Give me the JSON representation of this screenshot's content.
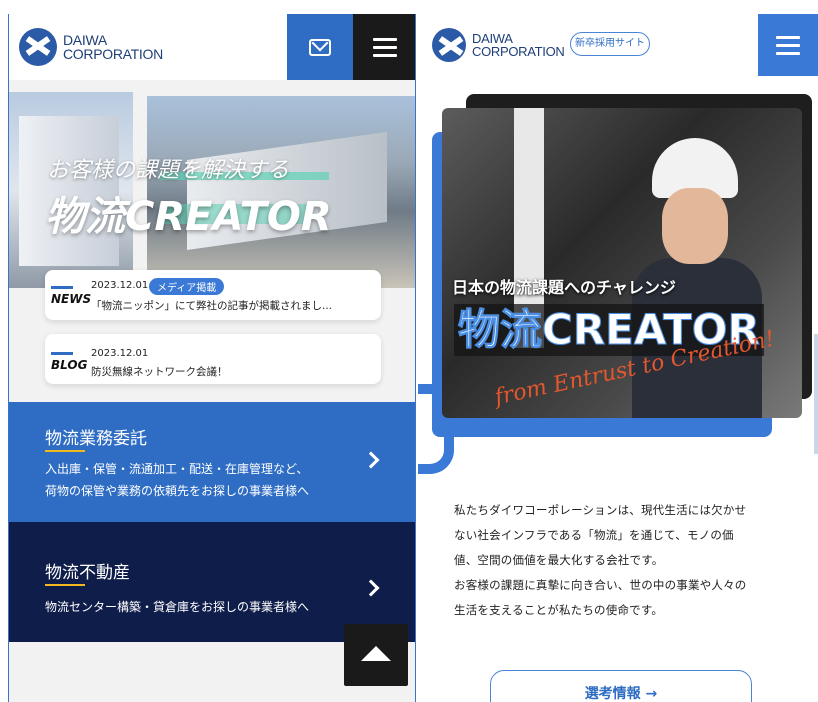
{
  "left": {
    "logo": {
      "line1": "DAIWA",
      "line2": "CORPORATION"
    },
    "hero": {
      "catch": "お客様の課題を解決する",
      "big": "物流CREATOR"
    },
    "news": {
      "tag": "NEWS",
      "date": "2023.12.01",
      "badge": "メディア掲載",
      "title": "「物流ニッポン」にて弊社の記事が掲載されまし..."
    },
    "blog": {
      "tag": "BLOG",
      "date": "2023.12.01",
      "title": "防災無線ネットワーク会議！"
    },
    "service1": {
      "title": "物流業務委託",
      "desc1": "入出庫・保管・流通加工・配送・在庫管理など、",
      "desc2": "荷物の保管や業務の依頼先をお探しの事業者様へ"
    },
    "service2": {
      "title": "物流不動産",
      "desc": "物流センター構築・貸倉庫をお探しの事業者様へ"
    }
  },
  "right": {
    "logo": {
      "line1": "DAIWA",
      "line2": "CORPORATION"
    },
    "recruit_label": "新卒採用サイト",
    "hero": {
      "sub": "日本の物流課題へのチャレンジ",
      "big": "物流CREATOR",
      "script": "from Entrust to Creation!"
    },
    "intro": [
      "私たちダイワコーポレーションは、現代生活には欠かせ",
      "ない社会インフラである「物流」を通じて、モノの価",
      "値、空間の価値を最大化する会社です。",
      "お客様の課題に真摯に向き合い、世の中の事業や人々の",
      "生活を支えることが私たちの使命です。"
    ],
    "button": "選考情報 →"
  },
  "colors": {
    "brand_blue": "#2f6dc4",
    "navy": "#0f1d4a",
    "accent_yellow": "#f2b91f",
    "dark": "#1a1a1a"
  }
}
